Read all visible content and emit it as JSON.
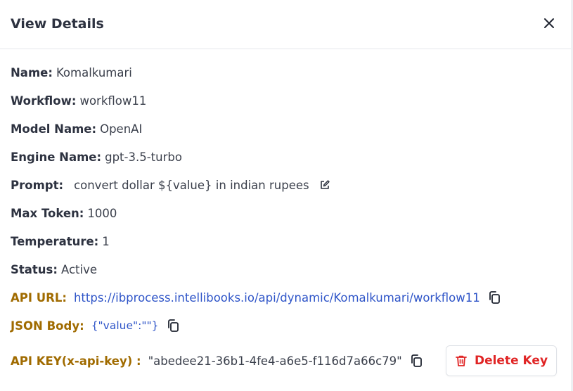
{
  "modal": {
    "title": "View Details",
    "close_icon": "close-icon"
  },
  "details": {
    "name": {
      "label": "Name:",
      "value": "Komalkumari"
    },
    "workflow": {
      "label": "Workflow:",
      "value": "workflow11"
    },
    "model_name": {
      "label": "Model Name:",
      "value": "OpenAI"
    },
    "engine_name": {
      "label": "Engine Name:",
      "value": "gpt-3.5-turbo"
    },
    "prompt": {
      "label": "Prompt:",
      "value": "convert dollar ${value} in indian rupees",
      "icon": "edit-icon"
    },
    "max_token": {
      "label": "Max Token:",
      "value": "1000"
    },
    "temperature": {
      "label": "Temperature:",
      "value": "1"
    },
    "status": {
      "label": "Status:",
      "value": "Active"
    },
    "api_url": {
      "label": "API URL:",
      "value": "https://ibprocess.intellibooks.io/api/dynamic/Komalkumari/workflow11",
      "icon": "copy-icon"
    },
    "json_body": {
      "label": "JSON Body:",
      "value": "{\"value\":\"\"}",
      "icon": "copy-icon"
    },
    "api_key": {
      "label": "API KEY(x-api-key) :",
      "value": "\"abedee21-36b1-4fe4-a6e5-f116d7a66c79\"",
      "icon": "copy-icon"
    }
  },
  "actions": {
    "delete_key_label": "Delete Key",
    "delete_icon": "trash-icon"
  },
  "colors": {
    "label_gold": "#a06b00",
    "link_blue": "#2f55c8",
    "danger_red": "#e02424"
  }
}
